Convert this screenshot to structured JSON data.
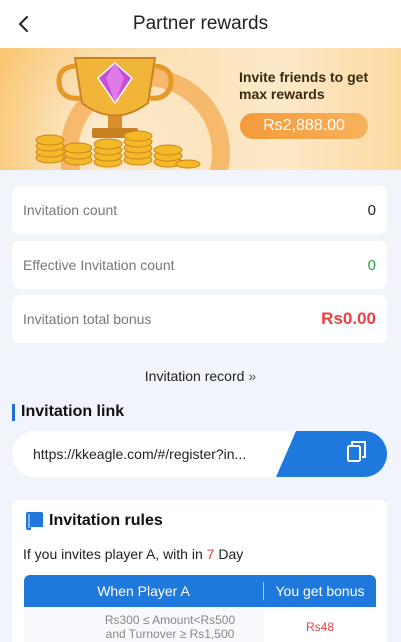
{
  "header": {
    "title": "Partner rewards"
  },
  "banner": {
    "headline": "Invite friends to get max rewards",
    "amount": "Rs2,888.00"
  },
  "stats": [
    {
      "label": "Invitation count",
      "value": "0"
    },
    {
      "label": "Effective Invitation count",
      "value": "0"
    },
    {
      "label": "Invitation total bonus",
      "value": "Rs0.00"
    }
  ],
  "record_link": {
    "label": "Invitation record",
    "chevron": "»"
  },
  "invite_link": {
    "title": "Invitation link",
    "url": "https://kkeagle.com/#/register?in..."
  },
  "rules": {
    "title": "Invitation rules",
    "desc_prefix": "If you invites player A, with in ",
    "desc_days": "7",
    "desc_suffix": " Day",
    "columns": {
      "when": "When Player A",
      "bonus": "You get bonus"
    },
    "rows": [
      {
        "condition_line1": "Rs300 ≤ Amount<Rs500",
        "condition_line2": "and Turnover ≥ Rs1,500",
        "bonus": "Rs48"
      }
    ]
  },
  "colors": {
    "accent_blue": "#1f78dc",
    "bonus_red": "#ee3f3f",
    "count_green": "#27a844",
    "banner_orange": "#f59a3b"
  },
  "icons": [
    "back-arrow-icon",
    "trophy-illustration",
    "copy-icon",
    "book-icon",
    "double-chevron-right-icon"
  ]
}
